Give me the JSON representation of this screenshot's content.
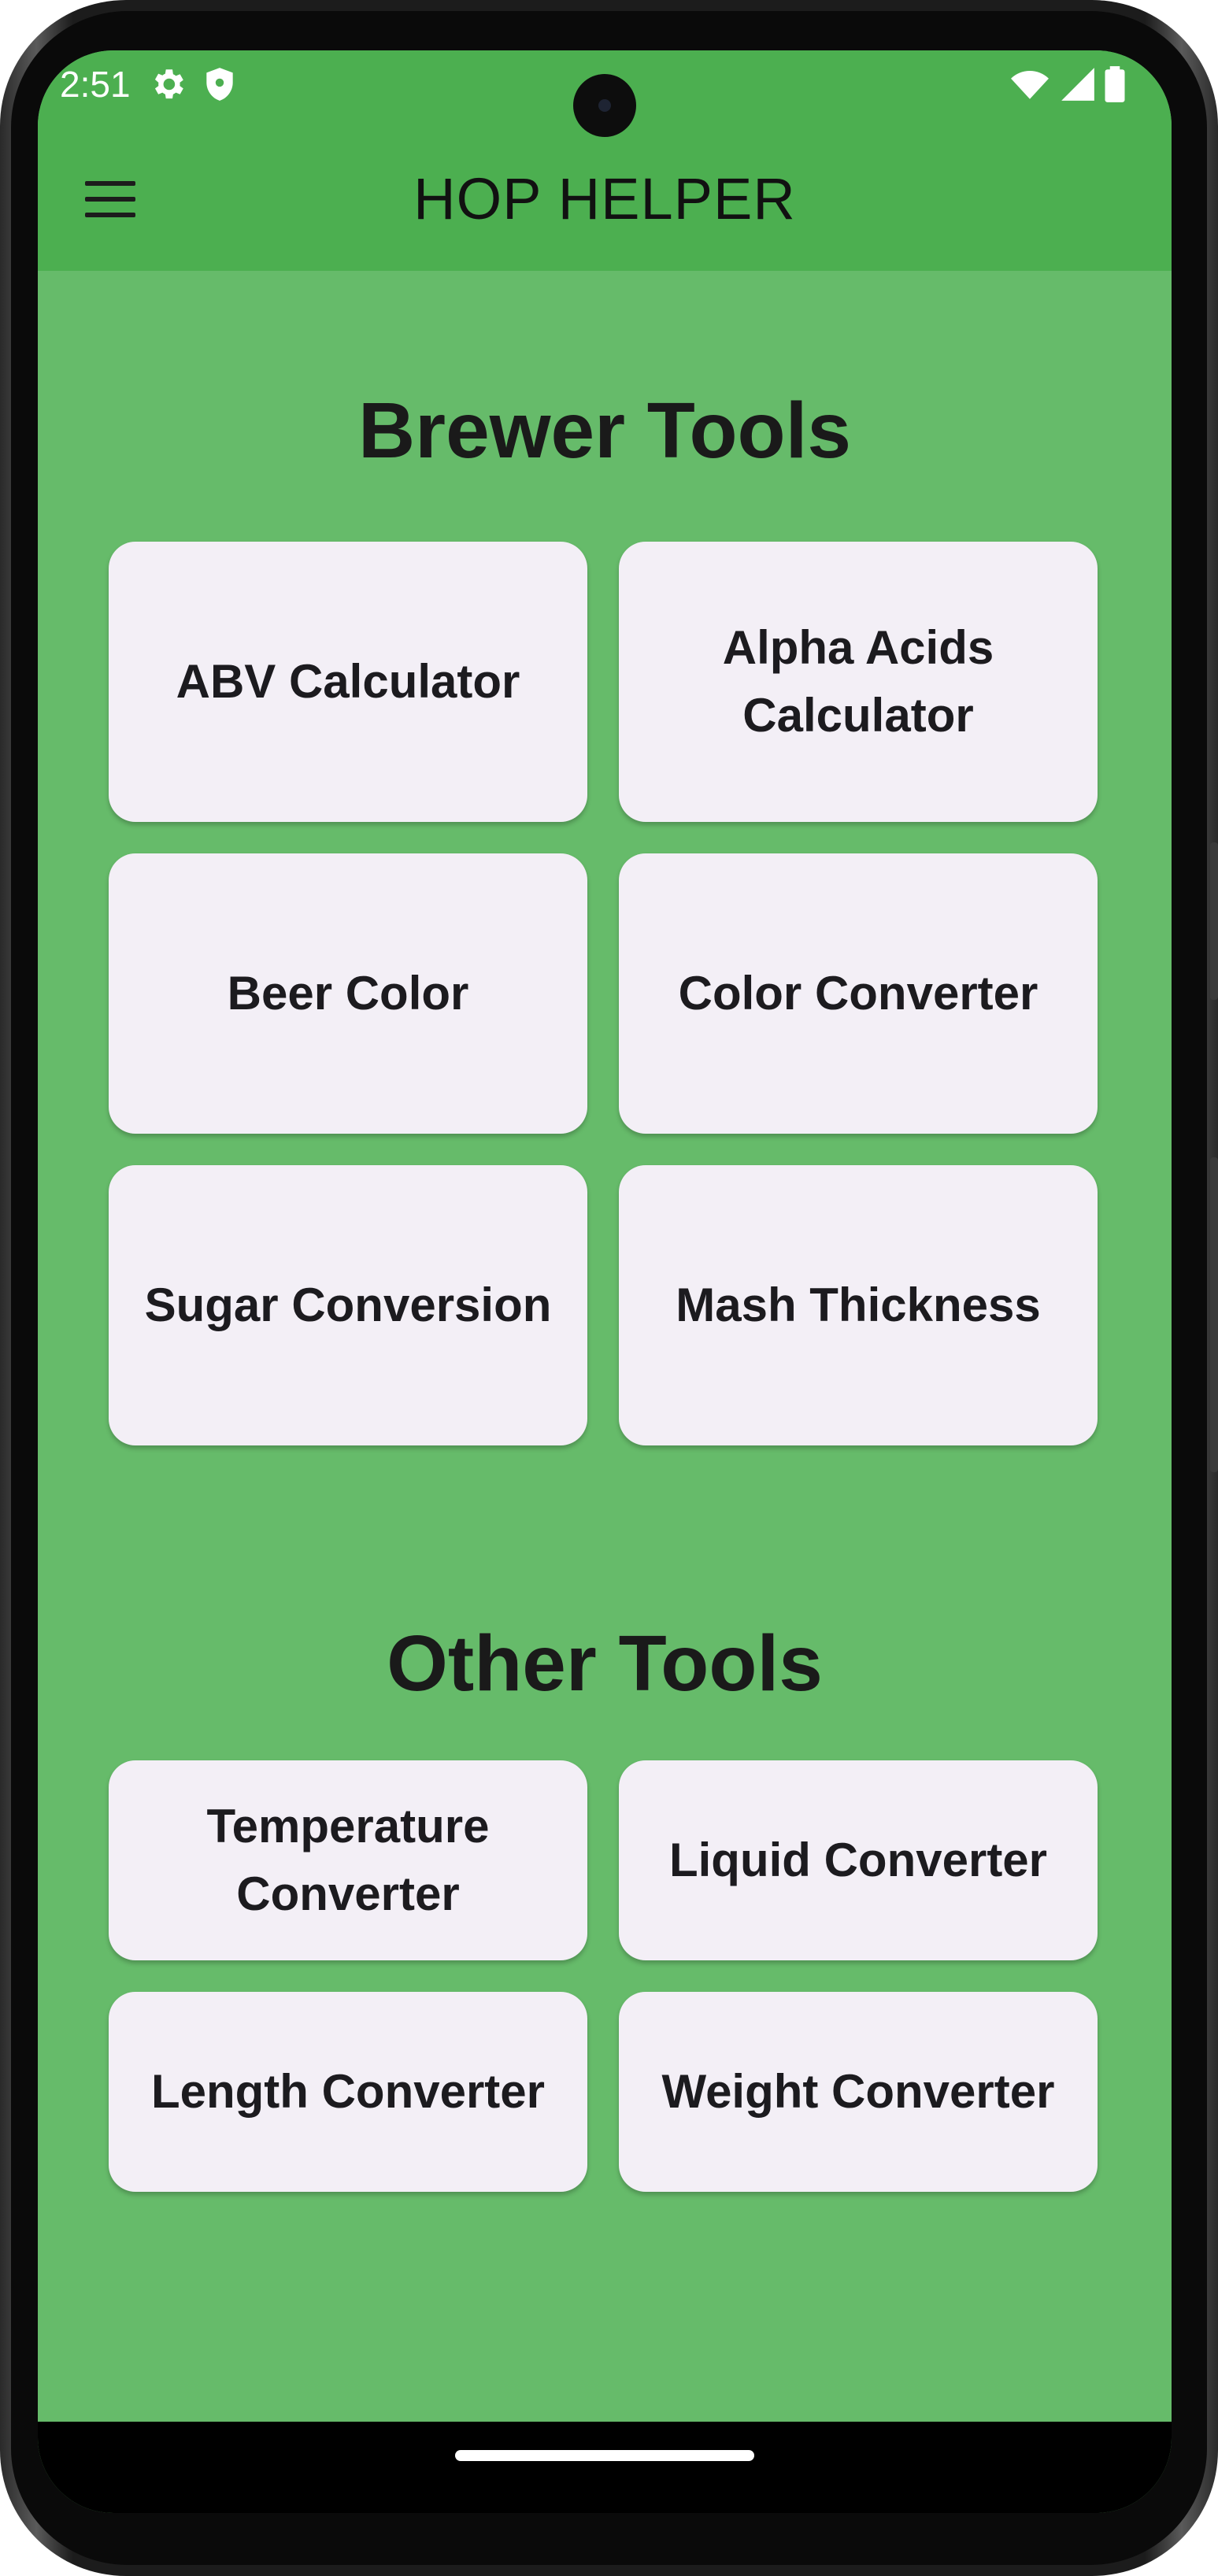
{
  "status_bar": {
    "time": "2:51",
    "icons": [
      "gear-icon",
      "shield-icon",
      "wifi-icon",
      "signal-icon",
      "battery-icon"
    ]
  },
  "app_bar": {
    "title": "HOP HELPER",
    "menu_icon": "hamburger-menu-icon"
  },
  "brewer_tools": {
    "title": "Brewer Tools",
    "items": [
      {
        "label": "ABV Calculator"
      },
      {
        "label": "Alpha Acids Calculator"
      },
      {
        "label": "Beer Color"
      },
      {
        "label": "Color Converter"
      },
      {
        "label": "Sugar Conversion"
      },
      {
        "label": "Mash Thickness"
      }
    ]
  },
  "other_tools": {
    "title": "Other Tools",
    "items": [
      {
        "label": "Temperature Converter"
      },
      {
        "label": "Liquid Converter"
      },
      {
        "label": "Length Converter"
      },
      {
        "label": "Weight Converter"
      }
    ]
  },
  "colors": {
    "app_bar": "#4caf50",
    "background": "#66bb6a",
    "card": "#f3eff6",
    "text": "#1c1b1f"
  }
}
